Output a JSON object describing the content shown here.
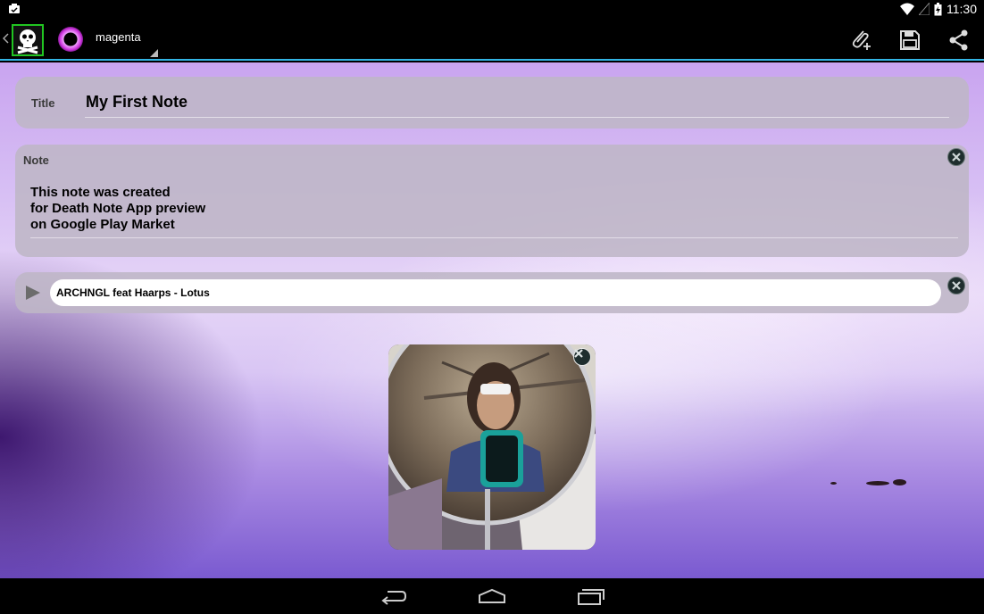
{
  "status_bar": {
    "time": "11:30",
    "icons": [
      "notification-icon",
      "wifi-icon",
      "signal-icon",
      "battery-icon"
    ]
  },
  "action_bar": {
    "up_icon": "chevron-left-icon",
    "app_icon": "skull-crossbones-icon",
    "color_icon": "color-ring-icon",
    "color_name": "magenta",
    "actions": [
      "attach-icon",
      "save-icon",
      "share-icon"
    ]
  },
  "title_field": {
    "label": "Title",
    "value": "My First Note"
  },
  "note_field": {
    "label": "Note",
    "lines": [
      "This note was created",
      "for Death Note App preview",
      "on Google Play Market"
    ]
  },
  "audio": {
    "track": "ARCHNGL feat Haarps - Lotus"
  },
  "nav_bar": {
    "icons": [
      "back-icon",
      "home-icon",
      "recents-icon"
    ]
  },
  "colors": {
    "accent": "#33b5e5",
    "logo_border": "#21c521",
    "magenta": "#cc33dd"
  }
}
